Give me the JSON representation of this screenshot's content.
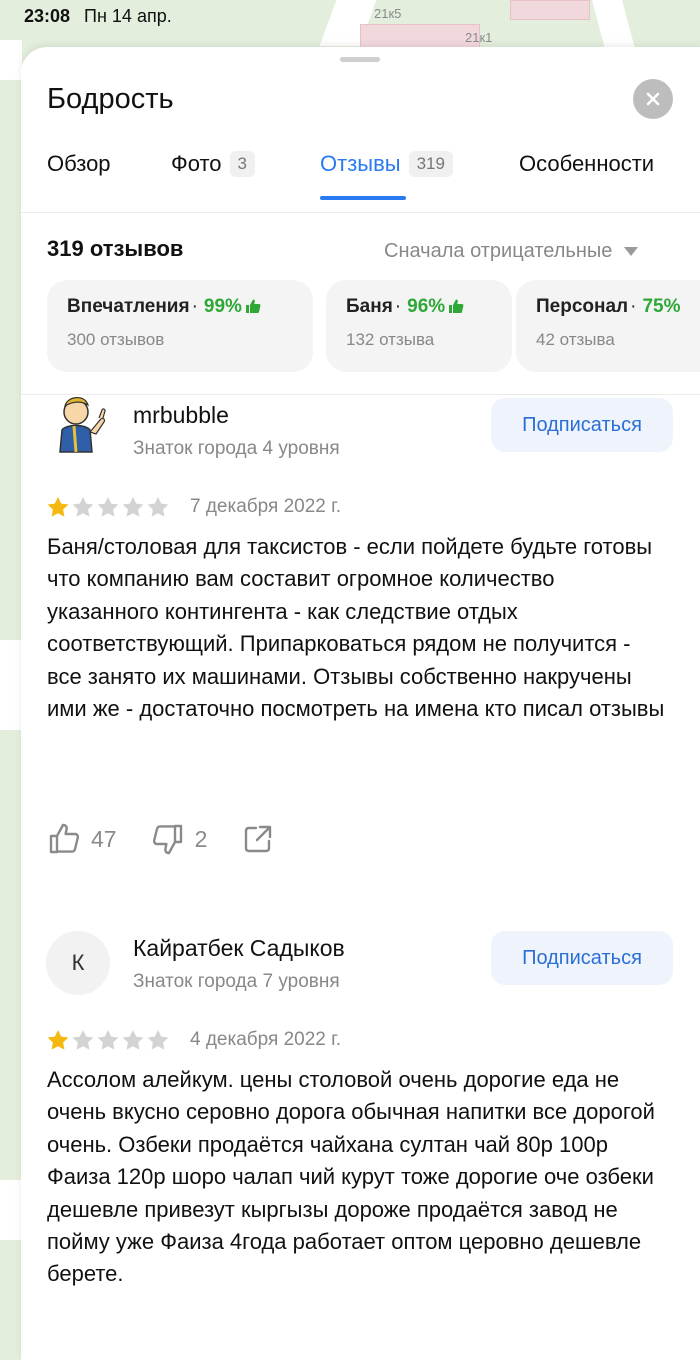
{
  "status_bar": {
    "time": "23:08",
    "date": "Пн 14 апр."
  },
  "map": {
    "labels": [
      "21к5",
      "21к1"
    ]
  },
  "place": {
    "title": "Бодрость"
  },
  "tabs": [
    {
      "label": "Обзор"
    },
    {
      "label": "Фото",
      "count": "3"
    },
    {
      "label": "Отзывы",
      "count": "319",
      "active": true
    },
    {
      "label": "Особенности"
    }
  ],
  "reviews_header": {
    "count_text": "319 отзывов",
    "sort_label": "Сначала отрицательные"
  },
  "aspects": [
    {
      "name": "Впечатления",
      "percent": "99%",
      "count": "300 отзывов"
    },
    {
      "name": "Баня",
      "percent": "96%",
      "count": "132 отзыва"
    },
    {
      "name": "Персонал",
      "percent": "75%",
      "count": "42 отзыва"
    }
  ],
  "reviews": [
    {
      "author": "mrbubble",
      "level": "Знаток города 4 уровня",
      "subscribe_label": "Подписаться",
      "rating": 1,
      "date": "7 декабря 2022 г.",
      "text": "Баня/столовая для таксистов - если пойдете будьте готовы что компанию вам составит огромное количество указанного контингента - как следствие отдых соответствующий. Припарковаться рядом не получится - все занято их машинами. Отзывы собственно накручены ими же - достаточно посмотреть на имена кто писал отзывы",
      "likes": "47",
      "dislikes": "2"
    },
    {
      "author": "Кайратбек Садыков",
      "avatar_letter": "К",
      "level": "Знаток города 7 уровня",
      "subscribe_label": "Подписаться",
      "rating": 1,
      "date": "4 декабря 2022 г.",
      "text": "Ассолом алейкум. цены столовой очень дорогие еда не очень вкусно серовно дорога обычная напитки все дорогой очень. Озбеки продаётся чайхана султан чай 80р 100р Фаиза 120р шоро чалап чий курут тоже дорогие оче озбеки дешевле привезут кыргызы дороже продаётся завод не пойму уже Фаиза 4года работает оптом церовно дешевле берете."
    }
  ],
  "colors": {
    "accent": "#2a7bf2",
    "positive": "#2ea836",
    "star_filled": "#f5b80f",
    "star_empty": "#d3d3d3"
  }
}
